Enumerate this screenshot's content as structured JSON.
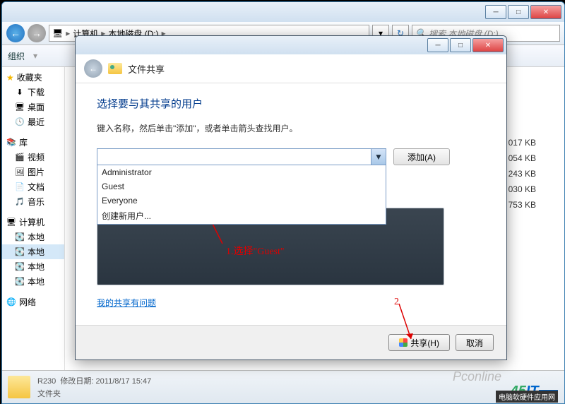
{
  "main_window": {
    "breadcrumb": {
      "computer": "计算机",
      "drive": "本地磁盘 (D:)"
    },
    "search_placeholder": "搜索 本地磁盘 (D:)",
    "toolbar": {
      "organize": "组织"
    },
    "sidebar": {
      "favorites": "收藏夹",
      "downloads": "下载",
      "desktop": "桌面",
      "recent": "最近",
      "libraries": "库",
      "videos": "视频",
      "pictures": "图片",
      "documents": "文档",
      "music": "音乐",
      "computer": "计算机",
      "local_c": "本地",
      "local_d": "本地",
      "local_e": "本地",
      "network": "网络"
    },
    "file_sizes": [
      "017 KB",
      "054 KB",
      "243 KB",
      "030 KB",
      "753 KB"
    ],
    "statusbar": {
      "name": "R230",
      "date_label": "修改日期:",
      "date": "2011/8/17 15:47",
      "type": "文件夹"
    }
  },
  "dialog": {
    "header_title": "文件共享",
    "heading": "选择要与其共享的用户",
    "instruction": "键入名称，然后单击\"添加\"，或者单击箭头查找用户。",
    "add_button": "添加(A)",
    "dropdown_items": [
      "Administrator",
      "Guest",
      "Everyone",
      "创建新用户..."
    ],
    "troubleshoot_link": "我的共享有问题",
    "share_button": "共享(H)",
    "cancel_button": "取消"
  },
  "annotations": {
    "step1": "1.选择\"Guest\"",
    "step2": "2"
  },
  "watermark": {
    "pc": "Pconline",
    "sub": "电脑软硬件应用网"
  }
}
